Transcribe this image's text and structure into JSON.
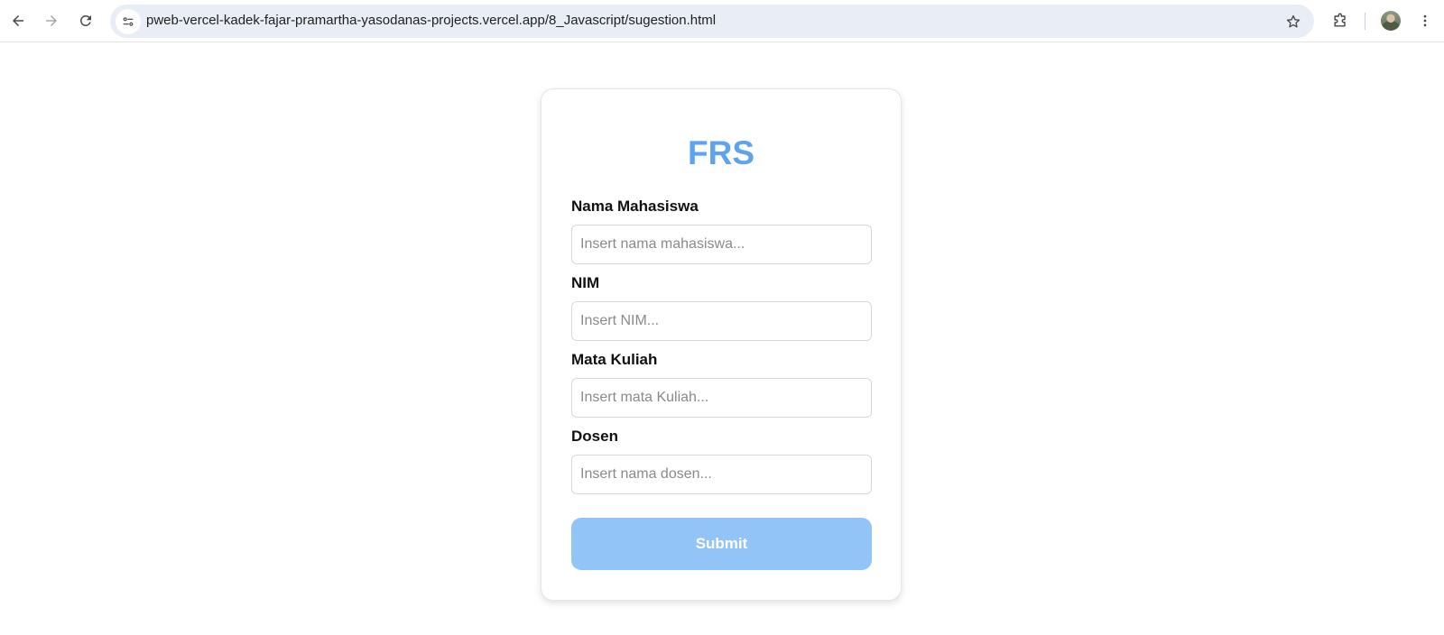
{
  "browser": {
    "url": "pweb-vercel-kadek-fajar-pramartha-yasodanas-projects.vercel.app/8_Javascript/sugestion.html",
    "icons": {
      "back": "back-arrow-icon",
      "forward": "forward-arrow-icon",
      "reload": "reload-icon",
      "site_info": "site-settings-icon",
      "bookmark": "star-icon",
      "extensions": "puzzle-icon",
      "profile": "avatar",
      "menu": "kebab-menu-icon"
    }
  },
  "form": {
    "title": "FRS",
    "fields": [
      {
        "label": "Nama Mahasiswa",
        "placeholder": "Insert nama mahasiswa...",
        "value": ""
      },
      {
        "label": "NIM",
        "placeholder": "Insert NIM...",
        "value": ""
      },
      {
        "label": "Mata Kuliah",
        "placeholder": "Insert mata Kuliah...",
        "value": ""
      },
      {
        "label": "Dosen",
        "placeholder": "Insert nama dosen...",
        "value": ""
      }
    ],
    "submit_label": "Submit"
  },
  "colors": {
    "title": "#5ea3ef",
    "submit_background": "#93c4f8",
    "omnibox": "#e9eef6"
  }
}
